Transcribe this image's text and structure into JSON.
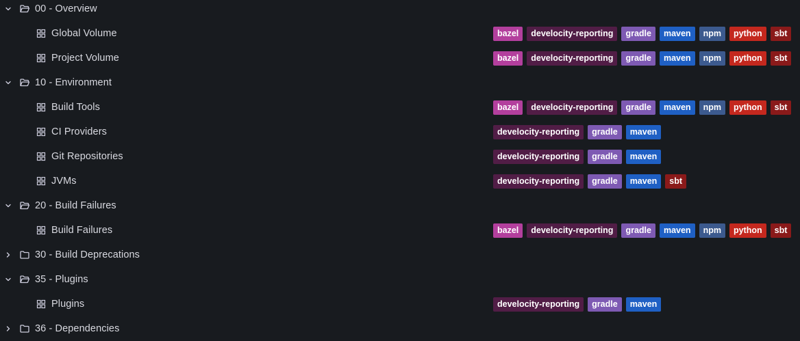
{
  "tag_colors": {
    "bazel": "#b33f9d",
    "develocity-reporting": "#511d46",
    "gradle": "#7e5ab3",
    "maven": "#1f60c4",
    "npm": "#3c5a8e",
    "python": "#c4281e",
    "sbt": "#8a1a1a"
  },
  "items": [
    {
      "type": "folder",
      "label": "00 - Overview",
      "expanded": true,
      "tags": []
    },
    {
      "type": "dashboard",
      "label": "Global Volume",
      "tags": [
        "bazel",
        "develocity-reporting",
        "gradle",
        "maven",
        "npm",
        "python",
        "sbt"
      ]
    },
    {
      "type": "dashboard",
      "label": "Project Volume",
      "tags": [
        "bazel",
        "develocity-reporting",
        "gradle",
        "maven",
        "npm",
        "python",
        "sbt"
      ]
    },
    {
      "type": "folder",
      "label": "10 - Environment",
      "expanded": true,
      "tags": []
    },
    {
      "type": "dashboard",
      "label": "Build Tools",
      "tags": [
        "bazel",
        "develocity-reporting",
        "gradle",
        "maven",
        "npm",
        "python",
        "sbt"
      ]
    },
    {
      "type": "dashboard",
      "label": "CI Providers",
      "tags": [
        "develocity-reporting",
        "gradle",
        "maven"
      ]
    },
    {
      "type": "dashboard",
      "label": "Git Repositories",
      "tags": [
        "develocity-reporting",
        "gradle",
        "maven"
      ]
    },
    {
      "type": "dashboard",
      "label": "JVMs",
      "tags": [
        "develocity-reporting",
        "gradle",
        "maven",
        "sbt"
      ]
    },
    {
      "type": "folder",
      "label": "20 - Build Failures",
      "expanded": true,
      "tags": []
    },
    {
      "type": "dashboard",
      "label": "Build Failures",
      "tags": [
        "bazel",
        "develocity-reporting",
        "gradle",
        "maven",
        "npm",
        "python",
        "sbt"
      ]
    },
    {
      "type": "folder",
      "label": "30 - Build Deprecations",
      "expanded": false,
      "tags": []
    },
    {
      "type": "folder",
      "label": "35 - Plugins",
      "expanded": true,
      "tags": []
    },
    {
      "type": "dashboard",
      "label": "Plugins",
      "tags": [
        "develocity-reporting",
        "gradle",
        "maven"
      ]
    },
    {
      "type": "folder",
      "label": "36 - Dependencies",
      "expanded": false,
      "tags": []
    }
  ]
}
